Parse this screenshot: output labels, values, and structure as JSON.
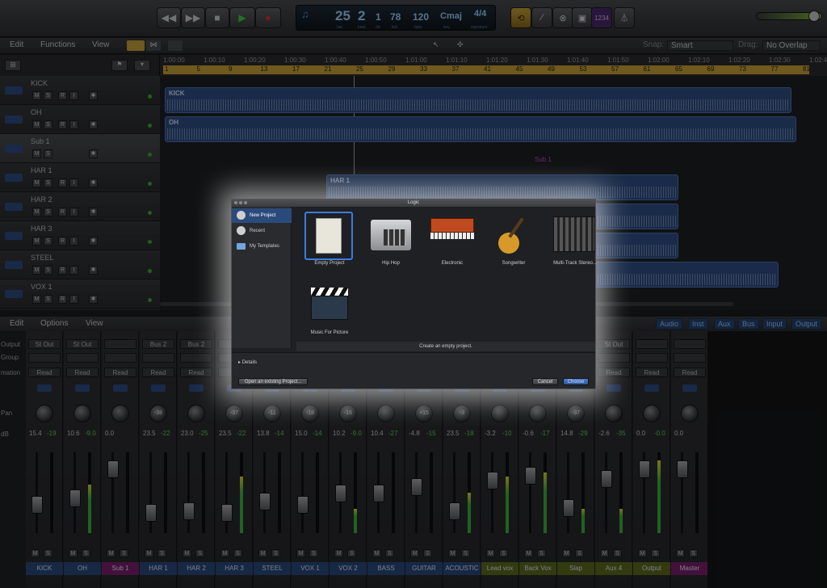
{
  "transport": {
    "lcd": {
      "bar": "25",
      "beat": "2",
      "div": "1",
      "tick": "78",
      "bpm": "120",
      "key": "Cmaj",
      "sig": "4/4",
      "bar_l": "bar",
      "beat_l": "beat",
      "div_l": "div",
      "tick_l": "tick",
      "bpm_l": "bpm",
      "key_l": "key",
      "sig_l": "signature"
    },
    "count_in": "1234"
  },
  "arrange_menu": {
    "edit": "Edit",
    "functions": "Functions",
    "view": "View",
    "snap_label": "Snap:",
    "snap_value": "Smart",
    "drag_label": "Drag:",
    "drag_value": "No Overlap"
  },
  "ruler": {
    "times": [
      "1:00:00",
      "1:00:10",
      "1:00:20",
      "1:00:30",
      "1:00:40",
      "1:00:50",
      "1:01:00",
      "1:01:10",
      "1:01:20",
      "1:01:30",
      "1:01:40",
      "1:01:50",
      "1:02:00",
      "1:02:10",
      "1:02:20",
      "1:02:30",
      "1:02:40"
    ],
    "bars": [
      "1",
      "5",
      "9",
      "13",
      "17",
      "21",
      "25",
      "29",
      "33",
      "37",
      "41",
      "45",
      "49",
      "53",
      "57",
      "61",
      "65",
      "69",
      "73",
      "77",
      "81"
    ]
  },
  "tracks": [
    {
      "name": "KICK"
    },
    {
      "name": "OH"
    },
    {
      "name": "Sub 1"
    },
    {
      "name": "HAR 1"
    },
    {
      "name": "HAR 2"
    },
    {
      "name": "HAR 3"
    },
    {
      "name": "STEEL"
    },
    {
      "name": "VOX 1"
    }
  ],
  "track_buttons": {
    "m": "M",
    "s": "S",
    "r": "R",
    "i": "I"
  },
  "regions": {
    "kick": "KICK",
    "oh": "OH",
    "sub": "Sub 1",
    "har1": "HAR 1"
  },
  "mixer_menu": {
    "edit": "Edit",
    "options": "Options",
    "view": "View",
    "tabs": [
      "Audio",
      "Inst",
      "Aux",
      "Bus",
      "Input",
      "Output"
    ]
  },
  "mixer_labels": {
    "output": "Output",
    "group": "Group",
    "automation": "mation",
    "pan": "Pan",
    "db": "dB"
  },
  "channels": [
    {
      "name": "KICK",
      "out": "St Out",
      "auto": "Read",
      "pan": "",
      "vol": "15.4",
      "peak": "-19",
      "color": "#2a4a7e"
    },
    {
      "name": "OH",
      "out": "St Out",
      "auto": "Read",
      "pan": "",
      "vol": "10.6",
      "peak": "-9.0",
      "color": "#2a4a7e"
    },
    {
      "name": "Sub 1",
      "out": "",
      "auto": "Read",
      "pan": "",
      "vol": "0.0",
      "peak": "",
      "color": "#7a1f6e"
    },
    {
      "name": "HAR 1",
      "out": "Bus 2",
      "auto": "Read",
      "pan": "-38",
      "vol": "23.5",
      "peak": "-22",
      "color": "#2a4a7e"
    },
    {
      "name": "HAR 2",
      "out": "Bus 2",
      "auto": "Read",
      "pan": "",
      "vol": "23.0",
      "peak": "-25",
      "color": "#2a4a7e"
    },
    {
      "name": "HAR 3",
      "out": "",
      "auto": "",
      "pan": "-37",
      "vol": "23.5",
      "peak": "-22",
      "color": "#2a4a7e"
    },
    {
      "name": "STEEL",
      "out": "",
      "auto": "",
      "pan": "-11",
      "vol": "13.8",
      "peak": "-14",
      "color": "#2a4a7e"
    },
    {
      "name": "VOX 1",
      "out": "",
      "auto": "",
      "pan": "-18",
      "vol": "15.0",
      "peak": "-14",
      "color": "#2a4a7e"
    },
    {
      "name": "VOX 2",
      "out": "",
      "auto": "",
      "pan": "-16",
      "vol": "10.2",
      "peak": "-9.0",
      "color": "#2a4a7e"
    },
    {
      "name": "BASS",
      "out": "",
      "auto": "",
      "pan": "",
      "vol": "10.4",
      "peak": "-27",
      "color": "#2a4a7e"
    },
    {
      "name": "GUITAR",
      "out": "",
      "auto": "",
      "pan": "+15",
      "vol": "-4.8",
      "peak": "-15",
      "color": "#2a4a7e"
    },
    {
      "name": "ACOUSTIC",
      "out": "",
      "auto": "",
      "pan": "-3",
      "vol": "23.5",
      "peak": "-18",
      "color": "#2a4a7e"
    },
    {
      "name": "Lead vox",
      "out": "",
      "auto": "",
      "pan": "",
      "vol": "-3.2",
      "peak": "-10",
      "color": "#5e6a1e"
    },
    {
      "name": "Back Vox",
      "out": "",
      "auto": "",
      "pan": "",
      "vol": "-0.6",
      "peak": "-17",
      "color": "#5e6a1e"
    },
    {
      "name": "Slap",
      "out": "",
      "auto": "",
      "pan": "-37",
      "vol": "14.8",
      "peak": "-29",
      "color": "#5e6a1e"
    },
    {
      "name": "Aux 4",
      "out": "St Out",
      "auto": "Read",
      "pan": "",
      "vol": "-2.6",
      "peak": "-35",
      "color": "#5e6a1e"
    },
    {
      "name": "Output",
      "out": "",
      "auto": "Read",
      "pan": "",
      "vol": "0.0",
      "peak": "-0.0",
      "color": "#5e6a1e"
    },
    {
      "name": "Master",
      "out": "",
      "auto": "Read",
      "pan": "",
      "vol": "0.0",
      "peak": "",
      "color": "#7a1f6e"
    }
  ],
  "bounce_label": "Bnc",
  "dialog": {
    "title": "Logic",
    "sidebar": [
      {
        "label": "New Project"
      },
      {
        "label": "Recent"
      },
      {
        "label": "My Templates"
      }
    ],
    "templates": [
      {
        "label": "Empty Project"
      },
      {
        "label": "Hip Hop"
      },
      {
        "label": "Electronic"
      },
      {
        "label": "Songwriter"
      },
      {
        "label": "Multi-Track Stereo..."
      },
      {
        "label": "Music For Picture"
      }
    ],
    "description": "Create an empty project.",
    "details": "Details",
    "open_existing": "Open an existing Project...",
    "cancel": "Cancel",
    "choose": "Choose"
  }
}
